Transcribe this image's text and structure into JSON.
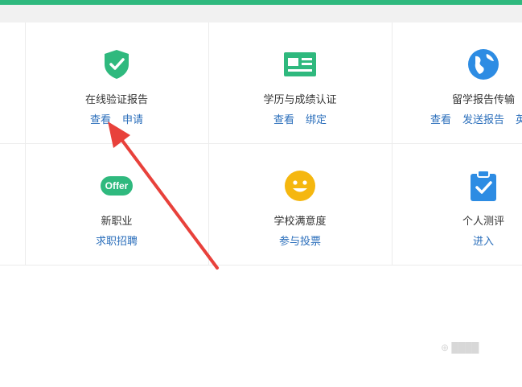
{
  "colors": {
    "accent": "#2fb97e",
    "link": "#2a6ebb",
    "arrow": "#e8413b"
  },
  "row1": [
    {
      "title": "在线验证报告",
      "icon": "shield-check-icon",
      "links": [
        "查看",
        "申请"
      ]
    },
    {
      "title": "学历与成绩认证",
      "icon": "id-card-icon",
      "links": [
        "查看",
        "绑定"
      ]
    },
    {
      "title": "留学报告传输",
      "icon": "globe-icon",
      "links": [
        "查看",
        "发送报告",
        "英文"
      ]
    }
  ],
  "row2": [
    {
      "title": "新职业",
      "icon": "offer-icon",
      "icon_text": "Offer",
      "links": [
        "求职招聘"
      ]
    },
    {
      "title": "学校满意度",
      "icon": "smiley-icon",
      "links": [
        "参与投票"
      ]
    },
    {
      "title": "个人测评",
      "icon": "clipboard-check-icon",
      "links": [
        "进入"
      ]
    }
  ]
}
